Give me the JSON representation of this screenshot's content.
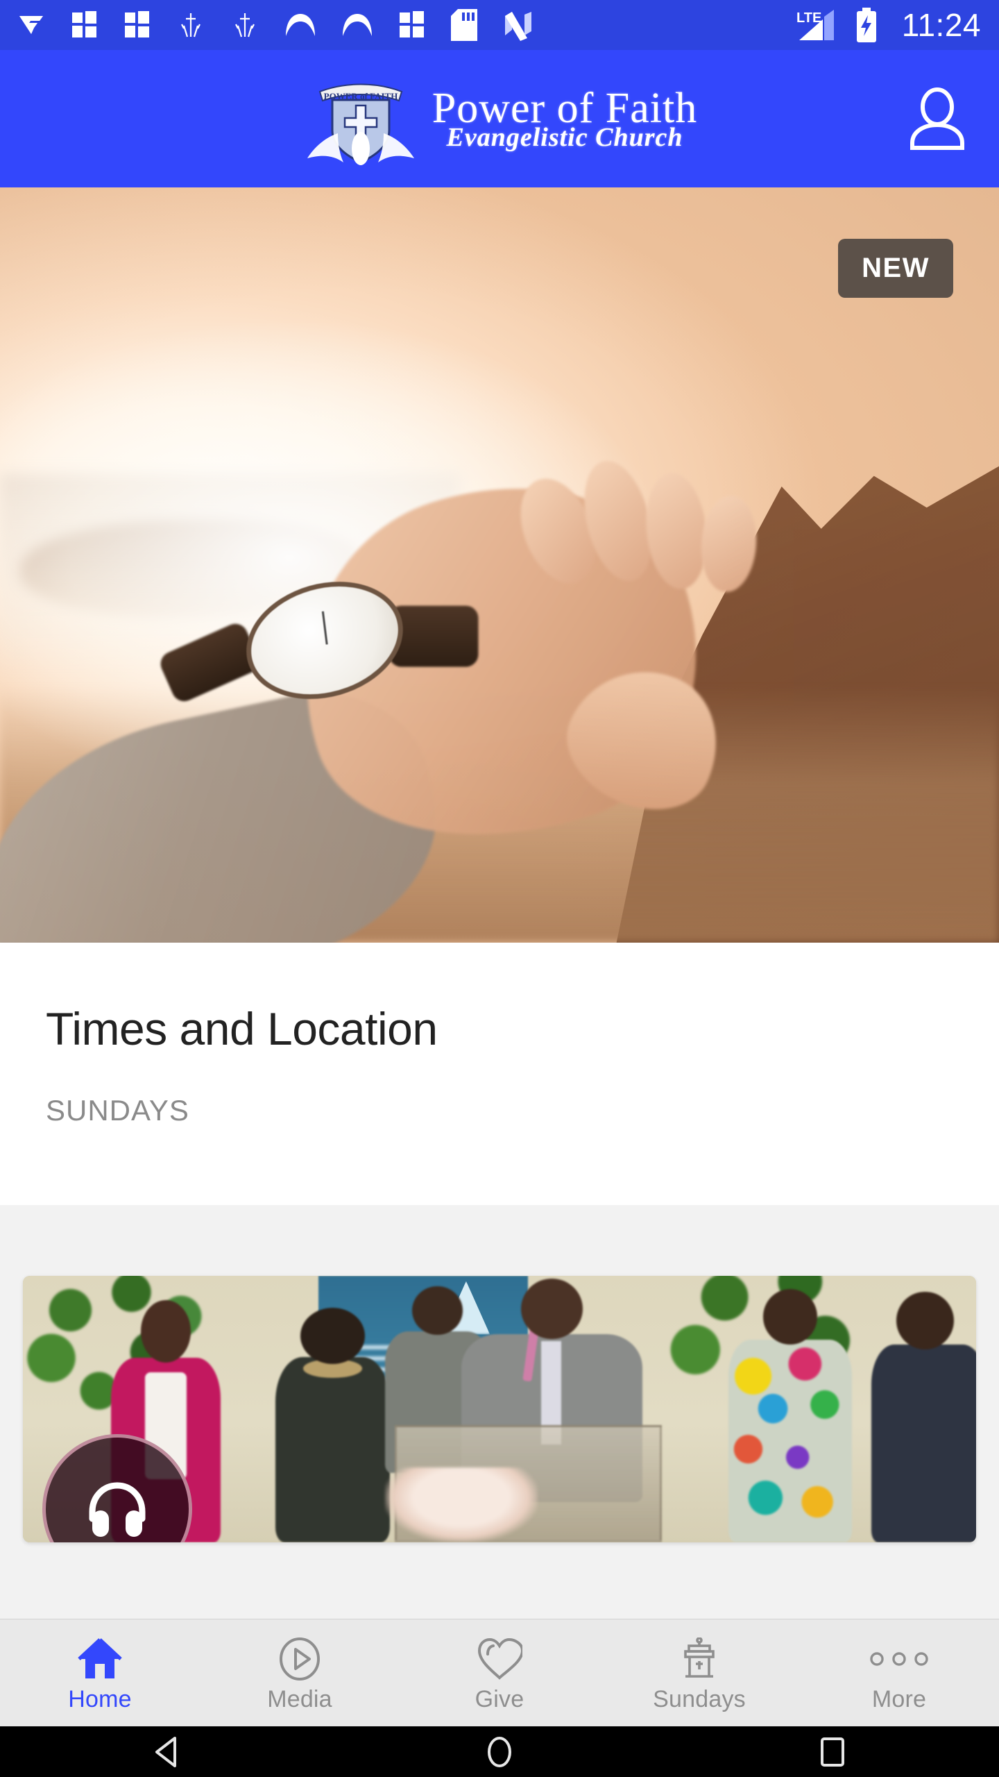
{
  "status_bar": {
    "time": "11:24",
    "network_label": "LTE",
    "notification_icons": [
      "v-logo-icon",
      "windows-tiles-icon",
      "windows-tiles-icon-2",
      "cross-worship-icon",
      "cross-worship-icon-2",
      "arc-icon",
      "arc-icon-2",
      "windows-tiles-icon-3",
      "sd-card-icon",
      "nougat-n-icon"
    ],
    "signal_icon": "signal-bars-icon",
    "battery_icon": "battery-charging-icon",
    "background_color": "#2d44e0"
  },
  "app_header": {
    "logo_icon": "power-of-faith-shield-dove-icon",
    "shield_banner_text": "POWER of FAITH",
    "title": "Power of Faith",
    "subtitle": "Evangelistic Church",
    "account_icon": "person-account-icon",
    "background_color": "#3347fc"
  },
  "hero": {
    "image_description": "hand-reaching-toward-sunset-over-water",
    "badge_label": "NEW",
    "badge_color": "#5c5149"
  },
  "times_card": {
    "title": "Times and Location",
    "subtitle": "SUNDAYS"
  },
  "media_card": {
    "image_description": "church-service-congregation-preacher-at-pulpit",
    "audio_icon": "headphones-icon"
  },
  "tab_bar": {
    "active_color": "#3347fc",
    "inactive_color": "#8e8e8e",
    "items": [
      {
        "label": "Home",
        "icon": "home-icon",
        "active": true
      },
      {
        "label": "Media",
        "icon": "play-circle-icon",
        "active": false
      },
      {
        "label": "Give",
        "icon": "heart-icon",
        "active": false
      },
      {
        "label": "Sundays",
        "icon": "pulpit-icon",
        "active": false
      },
      {
        "label": "More",
        "icon": "more-dots-icon",
        "active": false
      }
    ]
  },
  "system_nav": {
    "back_icon": "back-triangle-icon",
    "home_icon": "home-circle-icon",
    "recents_icon": "recents-square-icon"
  }
}
